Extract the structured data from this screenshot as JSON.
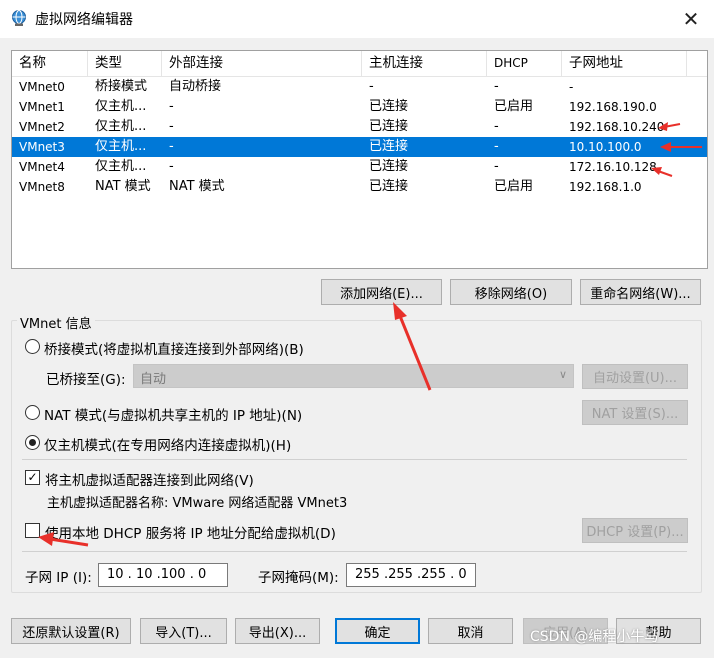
{
  "window": {
    "title": "虚拟网络编辑器",
    "close": "✕"
  },
  "table": {
    "columns": [
      "名称",
      "类型",
      "外部连接",
      "主机连接",
      "DHCP",
      "子网地址"
    ],
    "rows": [
      {
        "name": "VMnet0",
        "type": "桥接模式",
        "external": "自动桥接",
        "host": "-",
        "dhcp": "-",
        "subnet": "-"
      },
      {
        "name": "VMnet1",
        "type": "仅主机...",
        "external": "-",
        "host": "已连接",
        "dhcp": "已启用",
        "subnet": "192.168.190.0"
      },
      {
        "name": "VMnet2",
        "type": "仅主机...",
        "external": "-",
        "host": "已连接",
        "dhcp": "-",
        "subnet": "192.168.10.240"
      },
      {
        "name": "VMnet3",
        "type": "仅主机...",
        "external": "-",
        "host": "已连接",
        "dhcp": "-",
        "subnet": "10.10.100.0"
      },
      {
        "name": "VMnet4",
        "type": "仅主机...",
        "external": "-",
        "host": "已连接",
        "dhcp": "-",
        "subnet": "172.16.10.128"
      },
      {
        "name": "VMnet8",
        "type": "NAT 模式",
        "external": "NAT 模式",
        "host": "已连接",
        "dhcp": "已启用",
        "subnet": "192.168.1.0"
      }
    ],
    "selected_index": 3
  },
  "buttons": {
    "add_network": "添加网络(E)...",
    "remove_network": "移除网络(O)",
    "rename_network": "重命名网络(W)..."
  },
  "vmnet_info": {
    "group_label": "VMnet 信息",
    "bridged_radio": "桥接模式(将虚拟机直接连接到外部网络)(B)",
    "bridged_to_label": "已桥接至(G):",
    "bridged_to_value": "自动",
    "auto_settings": "自动设置(U)...",
    "nat_radio": "NAT 模式(与虚拟机共享主机的 IP 地址)(N)",
    "nat_settings": "NAT 设置(S)...",
    "hostonly_radio": "仅主机模式(在专用网络内连接虚拟机)(H)",
    "connect_adapter_check": "将主机虚拟适配器连接到此网络(V)",
    "adapter_name": "主机虚拟适配器名称: VMware 网络适配器 VMnet3",
    "dhcp_check": "使用本地 DHCP 服务将 IP 地址分配给虚拟机(D)",
    "dhcp_settings": "DHCP 设置(P)...",
    "subnet_ip_label": "子网 IP (I):",
    "subnet_ip_value": "10 . 10 .100 . 0",
    "subnet_mask_label": "子网掩码(M):",
    "subnet_mask_value": "255 .255 .255 . 0"
  },
  "footer": {
    "restore": "还原默认设置(R)",
    "import": "导入(T)...",
    "export": "导出(X)...",
    "ok": "确定",
    "cancel": "取消",
    "apply": "应用(A)",
    "help": "帮助"
  },
  "watermark": "CSDN @编程小牛马",
  "colors": {
    "selection": "#0078d7",
    "arrow": "#e8302a"
  }
}
